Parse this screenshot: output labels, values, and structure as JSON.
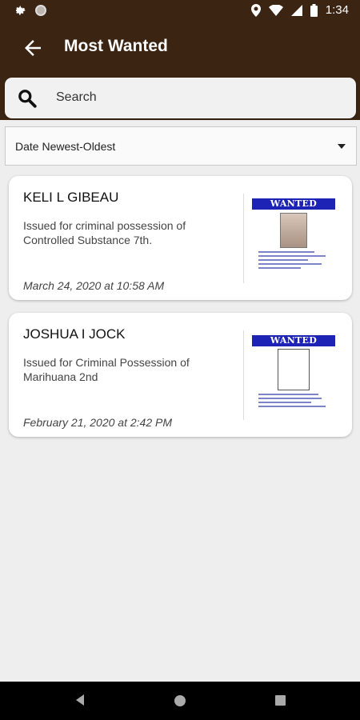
{
  "status_bar": {
    "time": "1:34"
  },
  "app_bar": {
    "title": "Most Wanted",
    "back_icon": "arrow-left-icon"
  },
  "search": {
    "placeholder": "Search",
    "icon": "search-icon"
  },
  "sort": {
    "selected": "Date Newest-Oldest"
  },
  "cards": [
    {
      "name": "KELI L GIBEAU",
      "description": "Issued for criminal possession of Controlled Substance 7th.",
      "date": "March 24, 2020 at 10:58 AM",
      "poster_label": "WANTED"
    },
    {
      "name": "JOSHUA I JOCK",
      "description": "Issued for Criminal Possession of Marihuana 2nd",
      "date": "February 21, 2020 at 2:42 PM",
      "poster_label": "WANTED"
    }
  ],
  "colors": {
    "brand": "#3b2412",
    "poster_banner": "#1d23b5"
  }
}
